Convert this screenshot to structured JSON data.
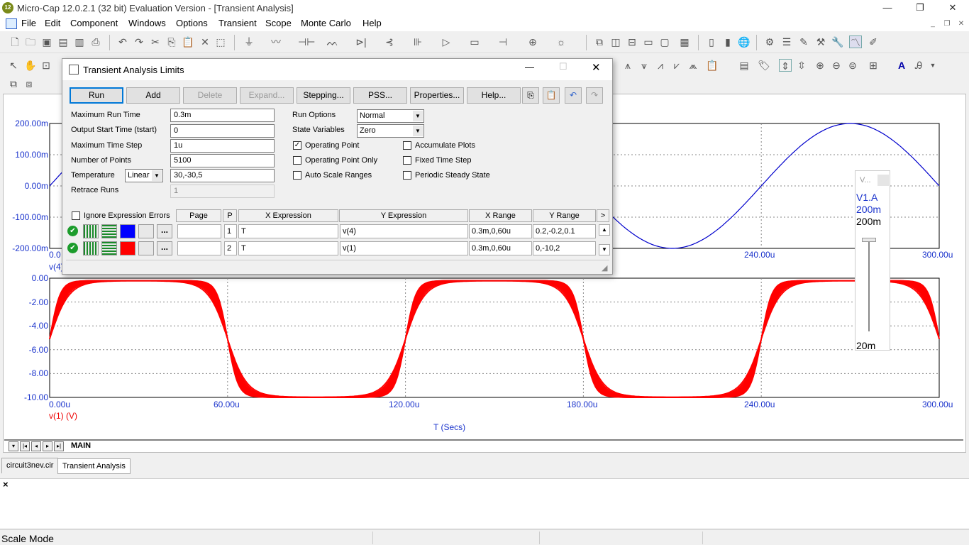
{
  "window": {
    "title": "Micro-Cap 12.0.2.1 (32 bit) Evaluation Version - [Transient Analysis]",
    "icon_label": "12",
    "minimize": "—",
    "restore": "❐",
    "close": "✕"
  },
  "menu": [
    "File",
    "Edit",
    "Component",
    "Windows",
    "Options",
    "Transient",
    "Scope",
    "Monte Carlo",
    "Help"
  ],
  "dialog": {
    "title": "Transient Analysis Limits",
    "buttons": {
      "run": "Run",
      "add": "Add",
      "delete": "Delete",
      "expand": "Expand...",
      "stepping": "Stepping...",
      "pss": "PSS...",
      "properties": "Properties...",
      "help": "Help..."
    },
    "labels": {
      "max_run_time": "Maximum Run Time",
      "output_start": "Output Start Time (tstart)",
      "max_time_step": "Maximum Time Step",
      "num_points": "Number of Points",
      "temperature": "Temperature",
      "retrace_runs": "Retrace Runs",
      "run_options": "Run Options",
      "state_variables": "State Variables"
    },
    "values": {
      "max_run_time": "0.3m",
      "output_start": "0",
      "max_time_step": "1u",
      "num_points": "5100",
      "temperature_mode": "Linear",
      "temperature": "30,-30,5",
      "retrace_runs": "1",
      "run_options": "Normal",
      "state_variables": "Zero"
    },
    "checkboxes": {
      "operating_point": "Operating Point",
      "operating_point_only": "Operating Point Only",
      "auto_scale": "Auto Scale Ranges",
      "accumulate": "Accumulate Plots",
      "fixed_step": "Fixed Time Step",
      "periodic": "Periodic Steady State",
      "ignore_errors": "Ignore Expression Errors"
    },
    "check_states": {
      "operating_point": true,
      "operating_point_only": false,
      "auto_scale": false,
      "accumulate": false,
      "fixed_step": false,
      "periodic": false,
      "ignore_errors": false
    },
    "grid_headers": {
      "page": "Page",
      "p": "P",
      "x": "X Expression",
      "y": "Y Expression",
      "xr": "X Range",
      "yr": "Y Range",
      "more": ">"
    },
    "rows": [
      {
        "p": "1",
        "x": "T",
        "y": "v(4)",
        "xr": "0.3m,0,60u",
        "yr": "0.2,-0.2,0.1",
        "color": "#0000ff"
      },
      {
        "p": "2",
        "x": "T",
        "y": "v(1)",
        "xr": "0.3m,0,60u",
        "yr": "0,-10,2",
        "color": "#ff0000"
      }
    ]
  },
  "plot_top": {
    "y_ticks": [
      "200.00m",
      "100.00m",
      "0.00m",
      "-100.00m",
      "-200.00m"
    ],
    "x_ticks_visible": [
      "240.00u",
      "300.00u"
    ],
    "x_first": "0.0",
    "trace_label": "v(4)"
  },
  "plot_bottom": {
    "y_ticks": [
      "0.00",
      "-2.00",
      "-4.00",
      "-6.00",
      "-8.00",
      "-10.00"
    ],
    "x_ticks": [
      "0.00u",
      "60.00u",
      "120.00u",
      "180.00u",
      "240.00u",
      "300.00u"
    ],
    "trace_label": "v(1) (V)",
    "x_axis_label": "T (Secs)"
  },
  "slider": {
    "title": "V...",
    "name": "V1.A",
    "value": "200m",
    "max": "200m",
    "min": "20m"
  },
  "sheet": {
    "tab": "MAIN"
  },
  "doc_tabs": [
    "circuit3nev.cir",
    "Transient Analysis"
  ],
  "output_pane": {
    "close": "×"
  },
  "status": {
    "text": "Scale Mode"
  },
  "colors": {
    "trace_blue": "#0000cc",
    "trace_red": "#ff0000",
    "axis_blue": "#1a33cc"
  },
  "chart_data": [
    {
      "type": "line",
      "series": [
        {
          "name": "v(4)",
          "description": "sine",
          "amplitude": 0.2,
          "period": 0.00012
        }
      ],
      "ylim": [
        -0.2,
        0.2
      ],
      "xlim": [
        0,
        0.0003
      ],
      "ylabel": "v(4)"
    },
    {
      "type": "line",
      "series": [
        {
          "name": "v(1)",
          "low": -10,
          "high": -0.2,
          "period": 0.00012,
          "runs": 13
        }
      ],
      "ylim": [
        -10,
        0
      ],
      "xlim": [
        0,
        0.0003
      ],
      "ylabel": "v(1) (V)",
      "xlabel": "T (Secs)"
    }
  ]
}
